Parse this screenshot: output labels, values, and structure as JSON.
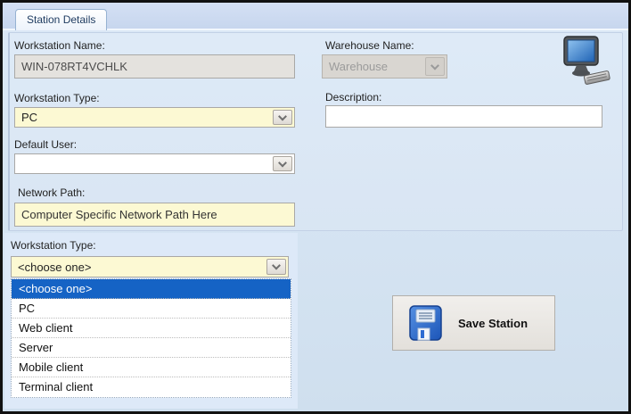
{
  "window": {
    "tab_label": "Station Details"
  },
  "form": {
    "workstation_name": {
      "label": "Workstation Name:",
      "value": "WIN-078RT4VCHLK"
    },
    "warehouse_name": {
      "label": "Warehouse Name:",
      "value": "Warehouse",
      "disabled": true
    },
    "workstation_type": {
      "label": "Workstation Type:",
      "value": "PC"
    },
    "description": {
      "label": "Description:",
      "value": ""
    },
    "default_user": {
      "label": "Default User:",
      "value": ""
    },
    "network_path": {
      "label": "Network Path:",
      "value": "Computer Specific Network Path Here"
    }
  },
  "type_picker": {
    "label": "Workstation Type:",
    "value": "<choose one>",
    "selected_index": 0,
    "options": [
      "<choose one>",
      "PC",
      "Web client",
      "Server",
      "Mobile client",
      "Terminal client"
    ]
  },
  "save": {
    "label": "Save Station"
  },
  "icons": {
    "computer_icon": "desktop-computer-with-keyboard",
    "floppy_icon": "floppy-disk-save",
    "dropdown_arrow": "chevron-down"
  },
  "colors": {
    "highlight_blue": "#1563c5",
    "field_yellow": "#fcf9d3",
    "readonly_gray": "#e4e2de",
    "disabled_gray": "#d9d6d1",
    "background_blue": "#d7e5f4"
  }
}
